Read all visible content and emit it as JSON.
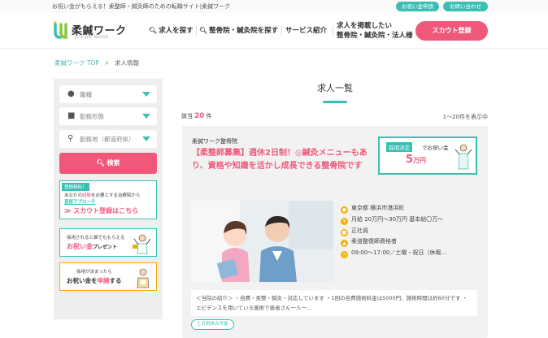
{
  "topbar": {
    "tagline": "お祝い金がもらえる！柔整師・鍼灸師のための転職サイト|柔鍼ワーク",
    "btn_bonus": "お祝い金申請",
    "btn_contact": "お問い合わせ"
  },
  "header": {
    "logo_text": "柔鍼ワーク",
    "logo_sub": "JUSHIN WORK",
    "nav": [
      {
        "label": "求人を探す",
        "icon": "search-icon"
      },
      {
        "label": "整骨院・鍼灸院を探す",
        "icon": "search-icon"
      },
      {
        "label": "サービス紹介"
      },
      {
        "label": "求人を掲載したい整骨院・鍼灸院・法人様"
      }
    ],
    "nav4_line1": "求人を掲載したい",
    "nav4_line2": "整骨院・鍼灸院・法人様",
    "scout_button": "スカウト登録"
  },
  "breadcrumb": {
    "home": "柔鍼ワーク TOP",
    "sep": ">",
    "current": "求人情報"
  },
  "sidebar": {
    "select_job": "職種",
    "select_employment": "勤務形態",
    "select_location": "勤務地（都道府県）",
    "search_button": "検索",
    "banner_scout": {
      "tag": "登録無料！",
      "line1a": "あなたの",
      "line1b": "経験",
      "line1c": "を必要とする治療院から",
      "line2": "直接アプローチ",
      "cta": "≫ スカウト登録はこちら"
    },
    "banner_present": {
      "line1": "採用されると誰でももらえる",
      "line2a": "お祝い金",
      "line2b": "プレゼント"
    },
    "banner_apply": {
      "line1": "採用が決まったら",
      "line2a": "お祝い金を",
      "line2b": "申請",
      "line2c": "する"
    }
  },
  "main": {
    "title": "求人一覧",
    "count_prefix": "該当",
    "count_value": "20",
    "count_suffix": "件",
    "range_text": "1～20件を表示中"
  },
  "job": {
    "clinic": "柔鍼ワーク整骨院",
    "title": "【柔整師募集】週休2日制！◎鍼灸メニューもあり、資格や知識を活かし成長できる整骨院です",
    "bonus_tag": "採用決定",
    "bonus_tag2": "でお祝い金",
    "bonus_amount": "5",
    "bonus_unit": "万円",
    "location": "東京都 横浜市港浜町",
    "salary": "月給 20万円～30万円 基本給〇万～",
    "employment": "正社員",
    "license": "柔道整復師資格者",
    "hours": "09:00～17:00／土曜・祝日（休暇…",
    "description": "＜当院の紹介＞ ・自費・柔整・鍼灸・対応しています ・1回の自費施術料金は5000円、施術時間は約60分です ・エビデンスを用いている施術で患者さん一人一…",
    "feature_tag": "土日祝休み可能"
  },
  "colors": {
    "accent": "#3bbfb3",
    "pink": "#f0587a",
    "yellow": "#f4b000"
  }
}
